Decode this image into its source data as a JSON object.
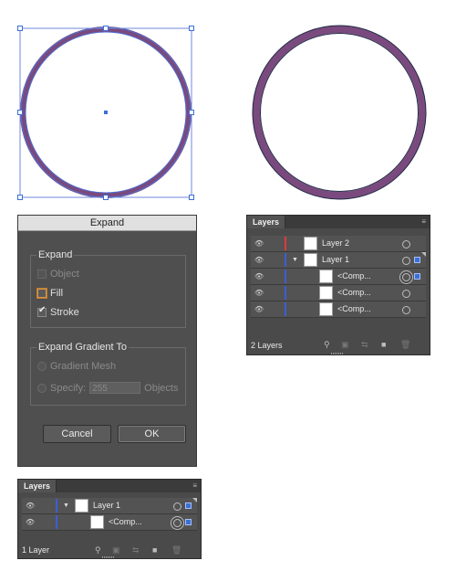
{
  "expand_dialog": {
    "title": "Expand",
    "expand_group": {
      "title": "Expand",
      "object_label": "Object",
      "fill_label": "Fill",
      "stroke_label": "Stroke"
    },
    "gradient_group": {
      "title": "Expand Gradient To",
      "gradient_mesh_label": "Gradient Mesh",
      "specify_label": "Specify:",
      "specify_value": "255",
      "objects_label": "Objects"
    },
    "cancel_label": "Cancel",
    "ok_label": "OK"
  },
  "layers_panel_top": {
    "tab_label": "Layers",
    "rows": [
      {
        "label": "Layer 2",
        "color": "#e03a3a"
      },
      {
        "label": "Layer 1",
        "color": "#3b5fd6"
      },
      {
        "label": "<Comp...",
        "color": "#3b5fd6"
      },
      {
        "label": "<Comp...",
        "color": "#3b5fd6"
      },
      {
        "label": "<Comp...",
        "color": "#3b5fd6"
      }
    ],
    "footer_count": "2 Layers"
  },
  "layers_panel_bottom": {
    "tab_label": "Layers",
    "rows": [
      {
        "label": "Layer 1",
        "color": "#3b5fd6"
      },
      {
        "label": "<Comp...",
        "color": "#3b5fd6"
      }
    ],
    "footer_count": "1 Layer"
  },
  "colors": {
    "ring_stroke": "#7a4a7e",
    "selection": "#3b6fd6",
    "panel_bg": "#4a4a4a",
    "dialog_bg": "#4f4f4f"
  }
}
